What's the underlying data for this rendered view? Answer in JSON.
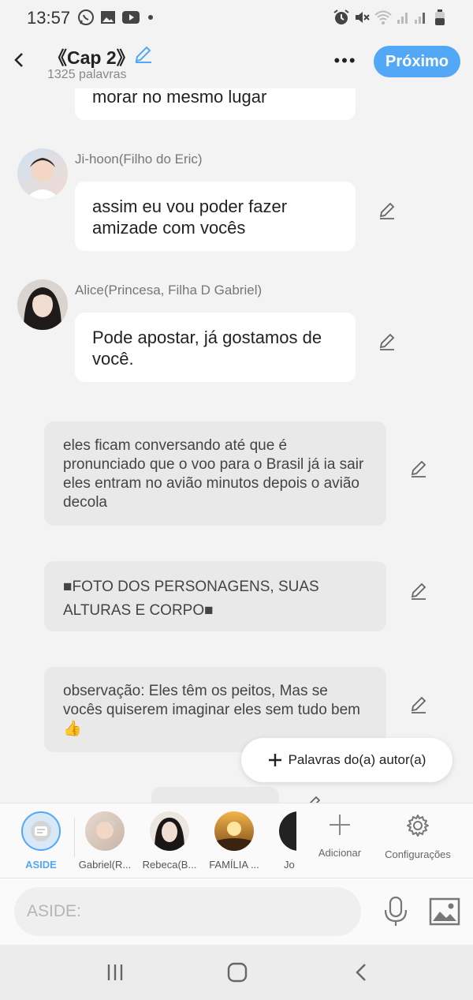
{
  "status": {
    "time": "13:57"
  },
  "header": {
    "title": "《Cap 2》",
    "word_count": "1325 palavras",
    "more_label": "•••",
    "next_label": "Próximo"
  },
  "messages": {
    "m0": {
      "text": "morar no mesmo lugar"
    },
    "m1": {
      "name": "Ji-hoon(Filho do Eric)",
      "text": "assim eu vou poder fazer amizade com vocês"
    },
    "m2": {
      "name": "Alice(Princesa, Filha D Gabriel)",
      "text": "Pode apostar, já gostamos de você."
    }
  },
  "narrations": [
    "eles ficam conversando até que é pronunciado que o voo para o Brasil já ia sair eles entram no avião minutos depois o avião decola",
    "■FOTO DOS PERSONAGENS, SUAS ALTURAS E CORPO■",
    "observação: Eles têm os peitos, Mas se vocês quiserem imaginar eles sem tudo bem👍"
  ],
  "author_words_button": "Palavras do(a) autor(a)",
  "characters": [
    {
      "label": "ASIDE"
    },
    {
      "label": "Gabriel(R..."
    },
    {
      "label": "Rebeca(B..."
    },
    {
      "label": "FAMÍLIA ..."
    },
    {
      "label": "Jo"
    }
  ],
  "tools": {
    "add": "Adicionar",
    "settings": "Configurações"
  },
  "input": {
    "placeholder": "ASIDE:"
  },
  "colors": {
    "accent": "#52a8f7",
    "narration_bg": "#e9e9e9",
    "bubble_bg": "#ffffff"
  }
}
